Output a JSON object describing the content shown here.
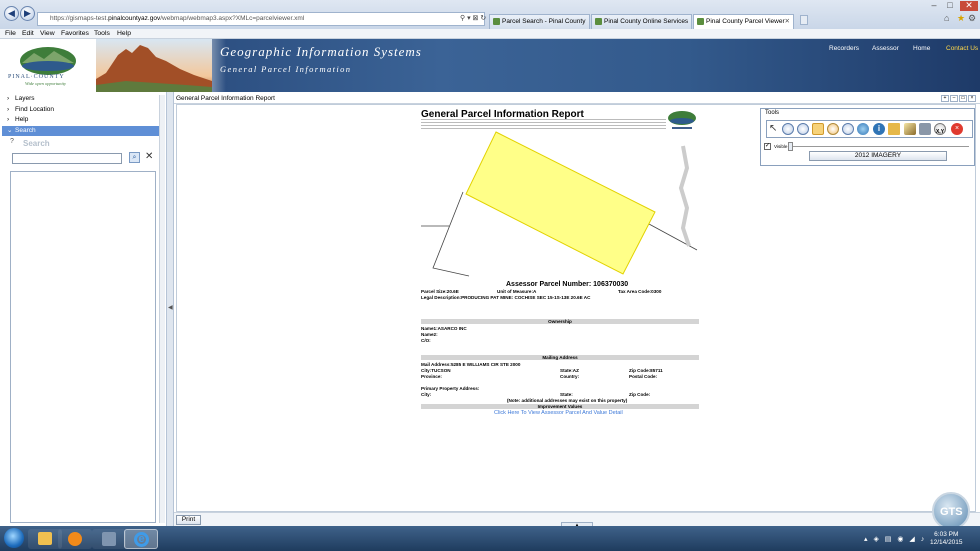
{
  "browser": {
    "address": "https://gismaps-test.pinalcountyaz.gov/webmap/webmap3.aspx?XMLc=parcelviewer.xml",
    "address_host": "pinalcountyaz.gov",
    "address_prefix": "https://gismaps-test.",
    "address_suffix": "/webmap/webmap3.aspx?XMLc=parcelviewer.xml",
    "search_icon": "⚲ ▾ ⊠ ↻",
    "tabs": [
      {
        "label": "Parcel Search - Pinal County"
      },
      {
        "label": "Pinal County Online Services"
      },
      {
        "label": "Pinal County Parcel Viewer"
      }
    ],
    "menu": [
      "File",
      "Edit",
      "View",
      "Favorites",
      "Tools",
      "Help"
    ]
  },
  "banner": {
    "logo_text": "PINAL·COUNTY",
    "logo_tagline": "Wide open opportunity",
    "title": "Geographic Information Systems",
    "subtitle": "General Parcel Information",
    "links": [
      "Recorders",
      "Assessor",
      "Home",
      "Contact Us"
    ],
    "active_link_color": "#ffd84a"
  },
  "sidebar": {
    "items": [
      {
        "label": "Layers"
      },
      {
        "label": "Find Location"
      },
      {
        "label": "Help"
      },
      {
        "label": "Search"
      }
    ],
    "search_heading": "Search",
    "search_value": ""
  },
  "main": {
    "header": "General Parcel Information Report",
    "print_label": "Print"
  },
  "report": {
    "title": "General Parcel Information Report",
    "parcel_heading": "Assessor Parcel Number: 106370030",
    "parcel_size": "Parcel Size:20.6E",
    "unit_measure": "Unit of Measure:A",
    "tax_area": "Tax Area Code:0300",
    "legal": "Legal Description:PRODUCING PAT MINE: COCHISE  SEC 15-1S-13E 20.6E AC",
    "ownership_bar": "Ownership",
    "name1": "Name1:ASARCO INC",
    "name2": "Name2:",
    "co": "C/O:",
    "mailing_bar": "Mailing Address",
    "mail_address": "Mail Address:5285 E WILLIAMS CIR STE 2000",
    "city": "City:TUCSON",
    "state": "State:AZ",
    "zip": "Zip Code:85711",
    "province": "Province:",
    "country": "Country:",
    "postal": "Postal Code:",
    "primary_addr": "Primary Property Address:",
    "city2": "City:",
    "state2": "State:",
    "zip2": "Zip Code:",
    "note": "(Note: additional addresses may exist on this property)",
    "improvement_bar": "Improvement Values",
    "link": "Click Here To View Assessor Parcel And Value Detail"
  },
  "tools": {
    "title": "Tools",
    "visible_label": "Visible",
    "imagery_button": "2012 IMAGERY",
    "icons": [
      "pointer-icon",
      "zoom-in-icon",
      "zoom-out-icon",
      "pan-icon",
      "zoom-extent-icon",
      "zoom-previous-icon",
      "full-extent-icon",
      "identify-icon",
      "measure-icon",
      "edit-icon",
      "print-icon",
      "xy-icon",
      "clear-icon"
    ]
  },
  "taskbar": {
    "time": "6:03 PM",
    "date": "12/14/2015"
  },
  "colors": {
    "parcel_fill": "#ffff88",
    "banner": "#2f5689",
    "selected": "#5f8fd6",
    "link": "#3c78d8"
  }
}
